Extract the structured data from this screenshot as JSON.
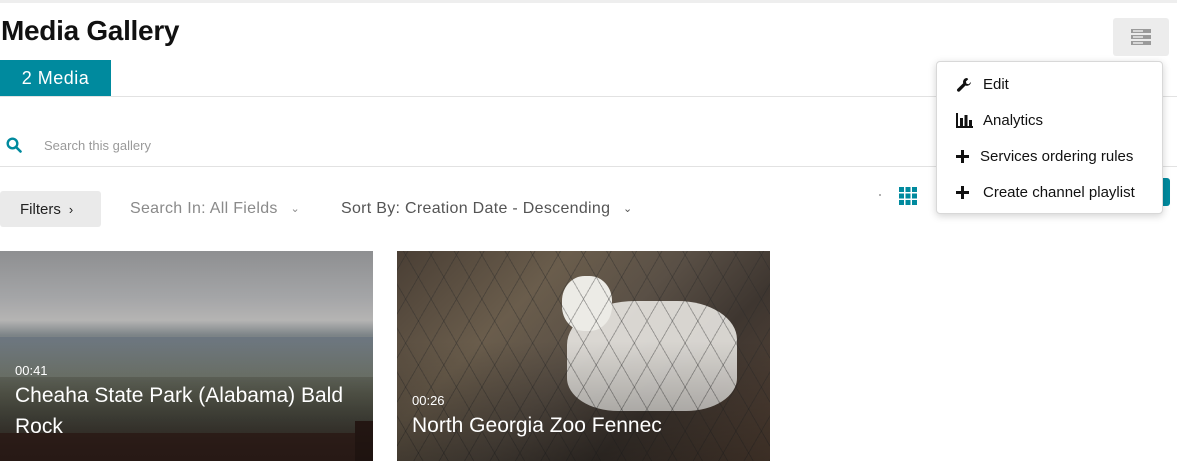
{
  "page": {
    "title": "Media Gallery"
  },
  "header": {
    "menu_icon": "list-menu-icon"
  },
  "tabs": [
    {
      "label": "2 Media"
    }
  ],
  "search": {
    "placeholder": "Search this gallery",
    "value": "",
    "icon": "search-icon"
  },
  "toolbar": {
    "filters_label": "Filters",
    "search_in_label": "Search In: All Fields",
    "sort_by_label": "Sort By: Creation Date - Descending",
    "view_icon": "grid-view-icon"
  },
  "dropdown": {
    "items": [
      {
        "label": "Edit",
        "icon": "wrench-icon"
      },
      {
        "label": "Analytics",
        "icon": "bar-chart-icon"
      },
      {
        "label": "Services ordering rules",
        "icon": "plus-icon"
      },
      {
        "label": "Create channel playlist",
        "icon": "plus-icon"
      }
    ]
  },
  "media": [
    {
      "duration": "00:41",
      "title": "Cheaha State Park (Alabama) Bald Rock"
    },
    {
      "duration": "00:26",
      "title": "North Georgia Zoo Fennec"
    }
  ],
  "colors": {
    "accent": "#008a9e",
    "button_bg": "#eaeaea",
    "text": "#222222"
  }
}
